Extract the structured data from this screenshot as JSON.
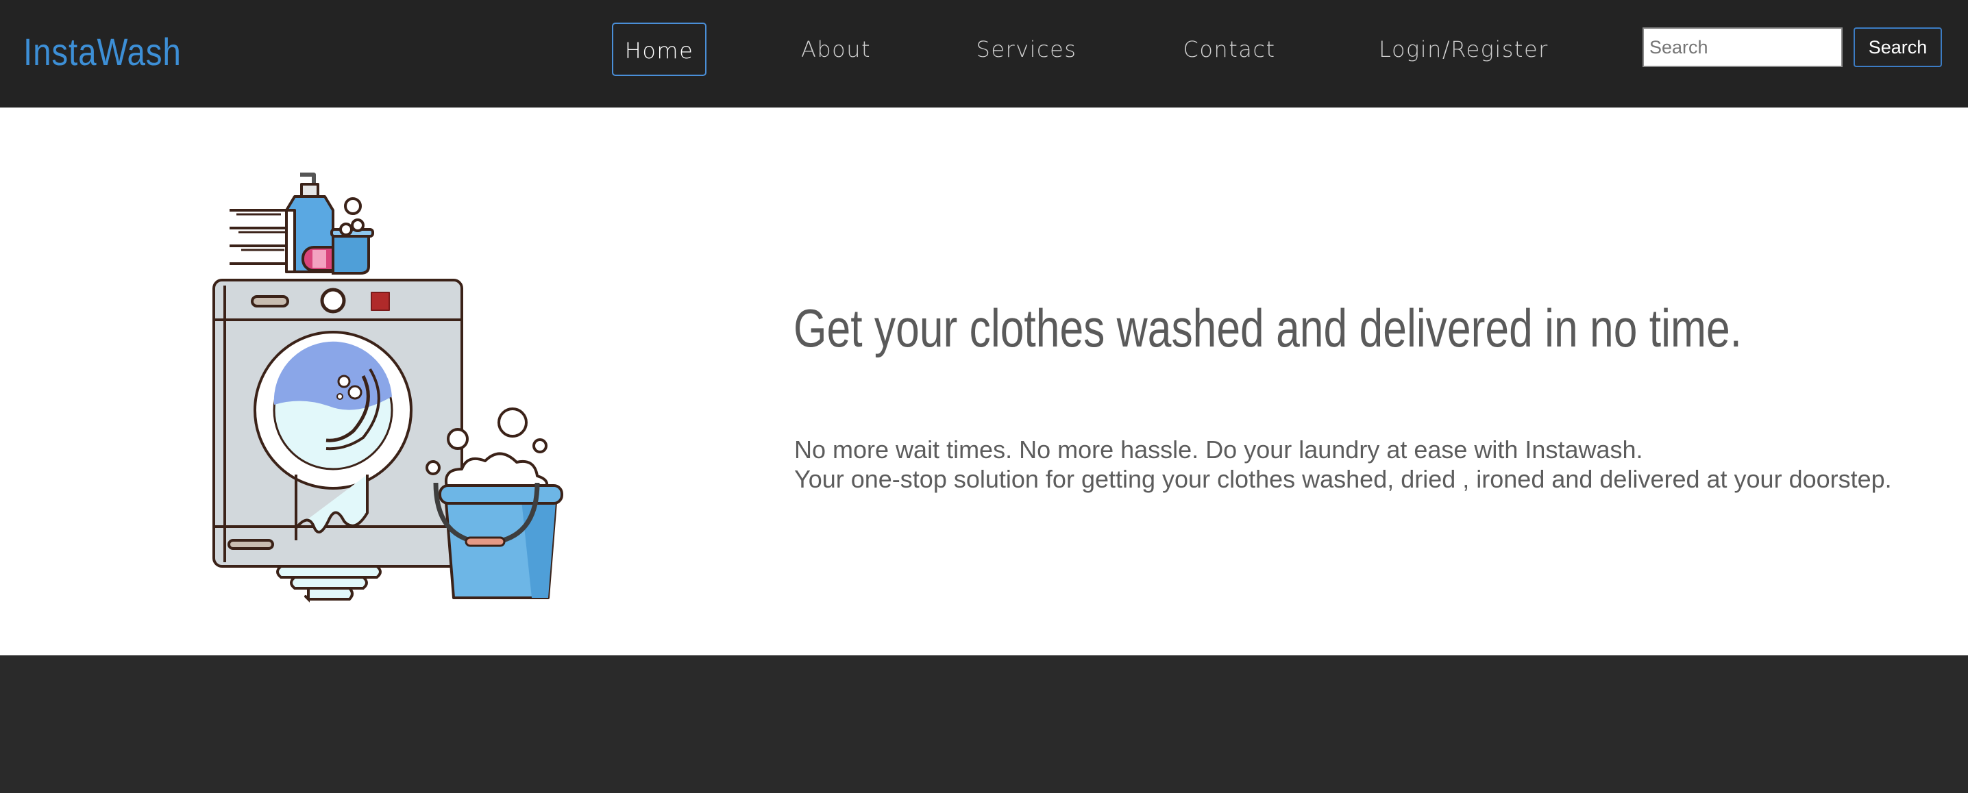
{
  "brand": {
    "name": "InstaWash",
    "color": "#3d8fd6"
  },
  "nav": {
    "items": [
      {
        "label": "Home",
        "active": true
      },
      {
        "label": "About",
        "active": false
      },
      {
        "label": "Services",
        "active": false
      },
      {
        "label": "Contact",
        "active": false
      },
      {
        "label": "Login/Register",
        "active": false
      }
    ]
  },
  "search": {
    "placeholder": "Search",
    "value": "",
    "button_label": "Search"
  },
  "hero": {
    "heading": "Get your clothes washed and delivered in no time.",
    "line1": "No more wait times. No more hassle. Do your laundry at ease with Instawash.",
    "line2": "Your one-stop solution for getting your clothes washed, dried , ironed and delivered at your doorstep.",
    "illustration": "washing-machine-illustration"
  },
  "colors": {
    "navbar": "#232323",
    "footer": "#2a2a2a",
    "accent": "#3d8fd6",
    "hero_bg": "#ffffff"
  }
}
